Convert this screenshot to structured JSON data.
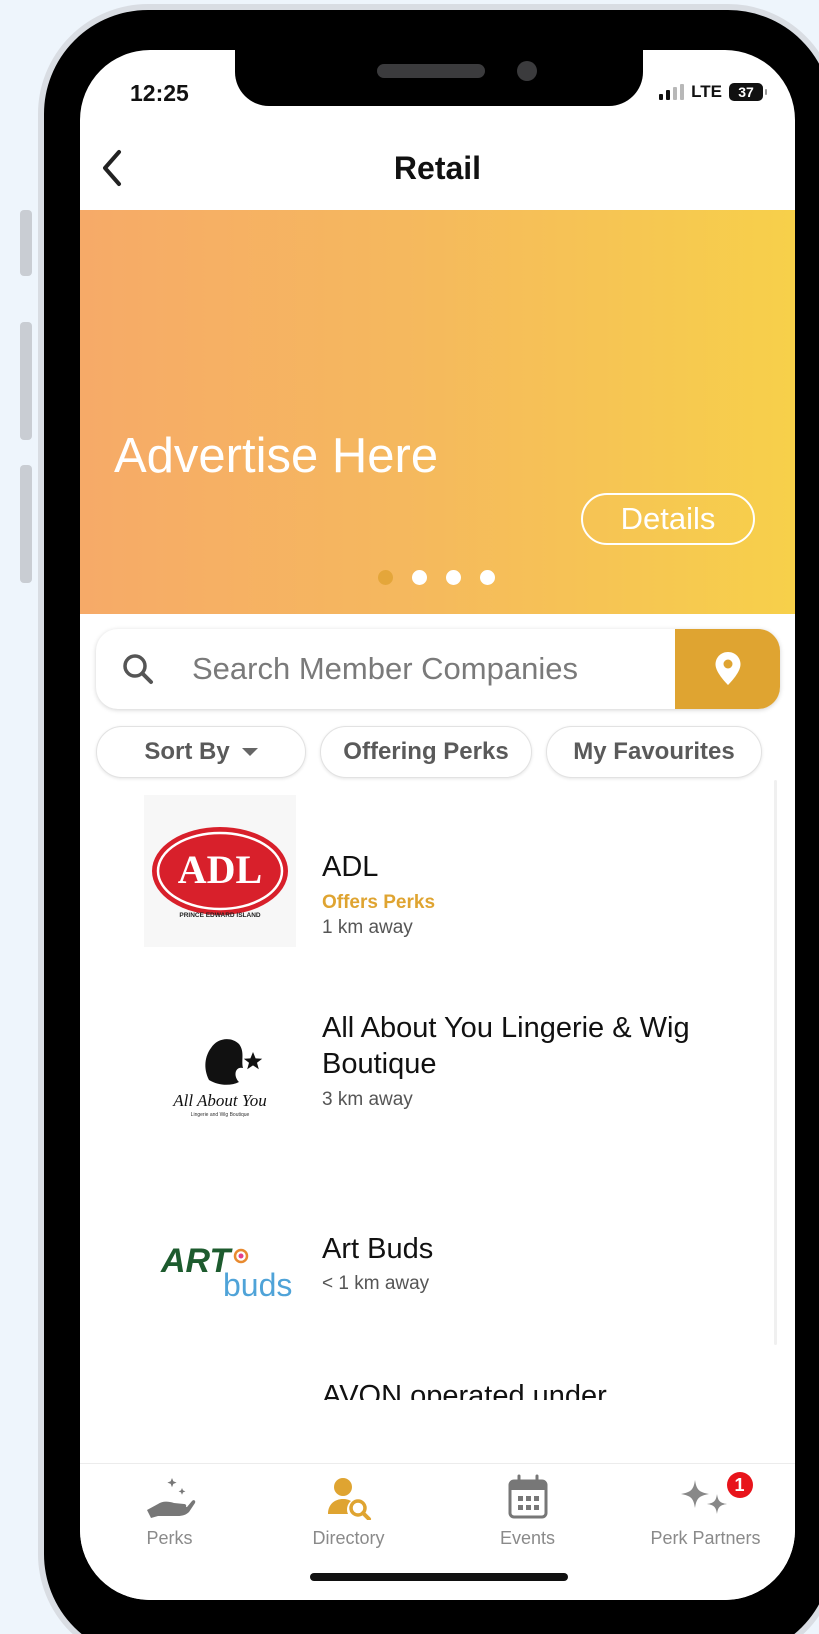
{
  "status_bar": {
    "time": "12:25",
    "network": "LTE",
    "battery": "37"
  },
  "header": {
    "title": "Retail",
    "back_icon": "chevron-left-icon"
  },
  "banner": {
    "text": "Advertise Here",
    "details_label": "Details",
    "carousel_dots": 4,
    "active_dot": 0,
    "gradient_start": "#f6aa68",
    "gradient_end": "#f7d04a"
  },
  "search": {
    "placeholder": "Search Member Companies",
    "icon": "search-icon",
    "location_icon": "map-pin-icon"
  },
  "filters": {
    "sort_label": "Sort By",
    "perks_label": "Offering Perks",
    "favourites_label": "My Favourites"
  },
  "companies": [
    {
      "name": "ADL",
      "perk": "Offers Perks",
      "distance": "1 km away",
      "logo_text": "ADL",
      "logo_subtext": "PRINCE EDWARD ISLAND"
    },
    {
      "name": "All About You Lingerie & Wig Boutique",
      "distance": "3 km away",
      "logo_text": "All About You",
      "logo_subtext": "Lingerie and Wig Boutique"
    },
    {
      "name": "Art Buds",
      "distance": "< 1 km away",
      "logo_text_1": "ART",
      "logo_text_2": "buds"
    },
    {
      "name": "AVON operated under"
    }
  ],
  "tabs": [
    {
      "label": "Perks",
      "icon": "hand-sparkle-icon"
    },
    {
      "label": "Directory",
      "icon": "person-search-icon",
      "active": true
    },
    {
      "label": "Events",
      "icon": "calendar-icon"
    },
    {
      "label": "Perk Partners",
      "icon": "sparkles-icon",
      "badge": "1"
    }
  ],
  "colors": {
    "accent": "#dfa431",
    "badge": "#e8141b",
    "adl_red": "#d8202b"
  }
}
